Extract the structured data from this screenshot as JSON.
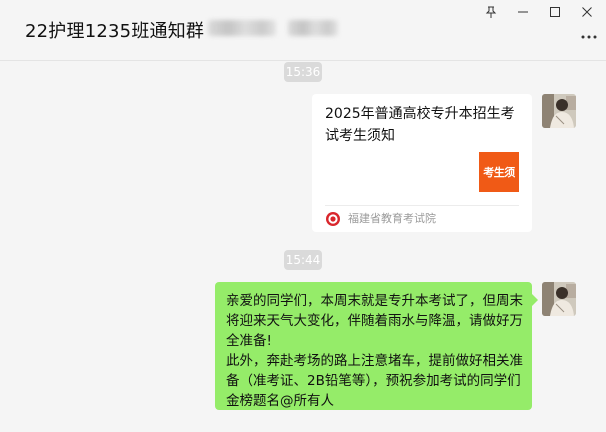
{
  "header": {
    "chat_title": "22护理1235班通知群"
  },
  "window_controls": [
    "pin-icon",
    "minimize-icon",
    "maximize-icon",
    "close-icon"
  ],
  "messages": [
    {
      "time": "15:36",
      "type": "link-card",
      "title": "2025年普通高校专升本招生考试考生须知",
      "thumb_text": "考生须",
      "source": "福建省教育考试院"
    },
    {
      "time": "15:44",
      "type": "text",
      "paragraphs": [
        "亲爱的同学们，本周末就是专升本考试了，但周末将迎来天气大变化，伴随着雨水与降温，请做好万全准备!",
        "此外，奔赴考场的路上注意堵车，提前做好相关准备（准考证、2B铅笔等），预祝参加考试的同学们金榜题名@所有人"
      ]
    }
  ],
  "colors": {
    "background": "#f5f5f5",
    "bubble_green": "#95ec69",
    "thumb_orange": "#f05a16",
    "time_pill": "#dadada"
  }
}
